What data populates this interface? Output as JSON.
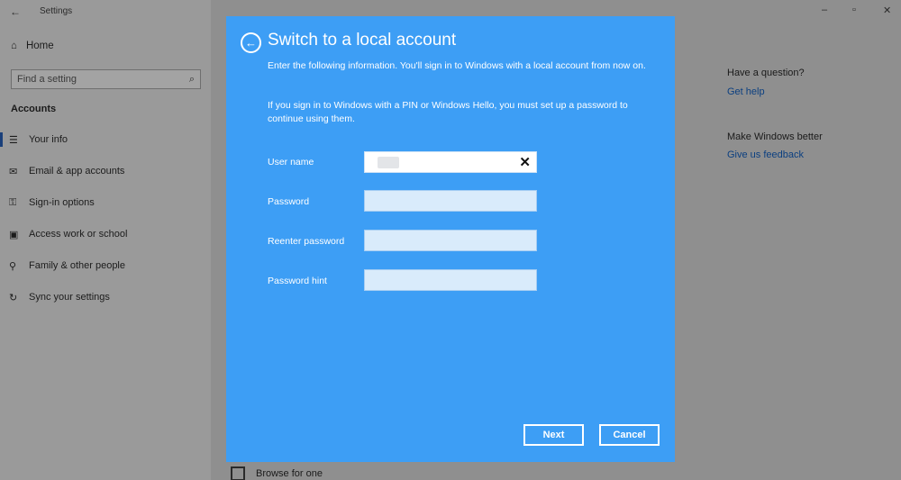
{
  "window": {
    "back_glyph": "←",
    "title": "Settings",
    "controls": [
      "–",
      "▫",
      "✕"
    ]
  },
  "sidebar": {
    "home": {
      "icon": "home-icon",
      "glyph": "⌂",
      "label": "Home"
    },
    "search": {
      "placeholder": "Find a setting",
      "icon": "search-icon",
      "glyph": "⌕"
    },
    "section_title": "Accounts",
    "items": [
      {
        "icon": "person-card-icon",
        "glyph": "☰",
        "label": "Your info",
        "active": true
      },
      {
        "icon": "mail-icon",
        "glyph": "✉",
        "label": "Email & app accounts"
      },
      {
        "icon": "key-icon",
        "glyph": "⚿",
        "label": "Sign-in options"
      },
      {
        "icon": "briefcase-icon",
        "glyph": "▣",
        "label": "Access work or school"
      },
      {
        "icon": "person-icon",
        "glyph": "⚲",
        "label": "Family & other people"
      },
      {
        "icon": "sync-icon",
        "glyph": "↻",
        "label": "Sync your settings"
      }
    ]
  },
  "right_panel": {
    "question_title": "Have a question?",
    "help_link": "Get help",
    "feedback_title": "Make Windows better",
    "feedback_link": "Give us feedback"
  },
  "background": {
    "browse_label": "Browse for one"
  },
  "dialog": {
    "back_glyph": "←",
    "title": "Switch to a local account",
    "intro": "Enter the following information. You'll sign in to Windows with a local account from now on.",
    "note": "If you sign in to Windows with a PIN or Windows Hello, you must set up a password to continue using them.",
    "fields": [
      {
        "label": "User name",
        "value": ""
      },
      {
        "label": "Password",
        "value": ""
      },
      {
        "label": "Reenter password",
        "value": ""
      },
      {
        "label": "Password hint",
        "value": ""
      }
    ],
    "clear_glyph": "✕",
    "next_label": "Next",
    "cancel_label": "Cancel"
  }
}
